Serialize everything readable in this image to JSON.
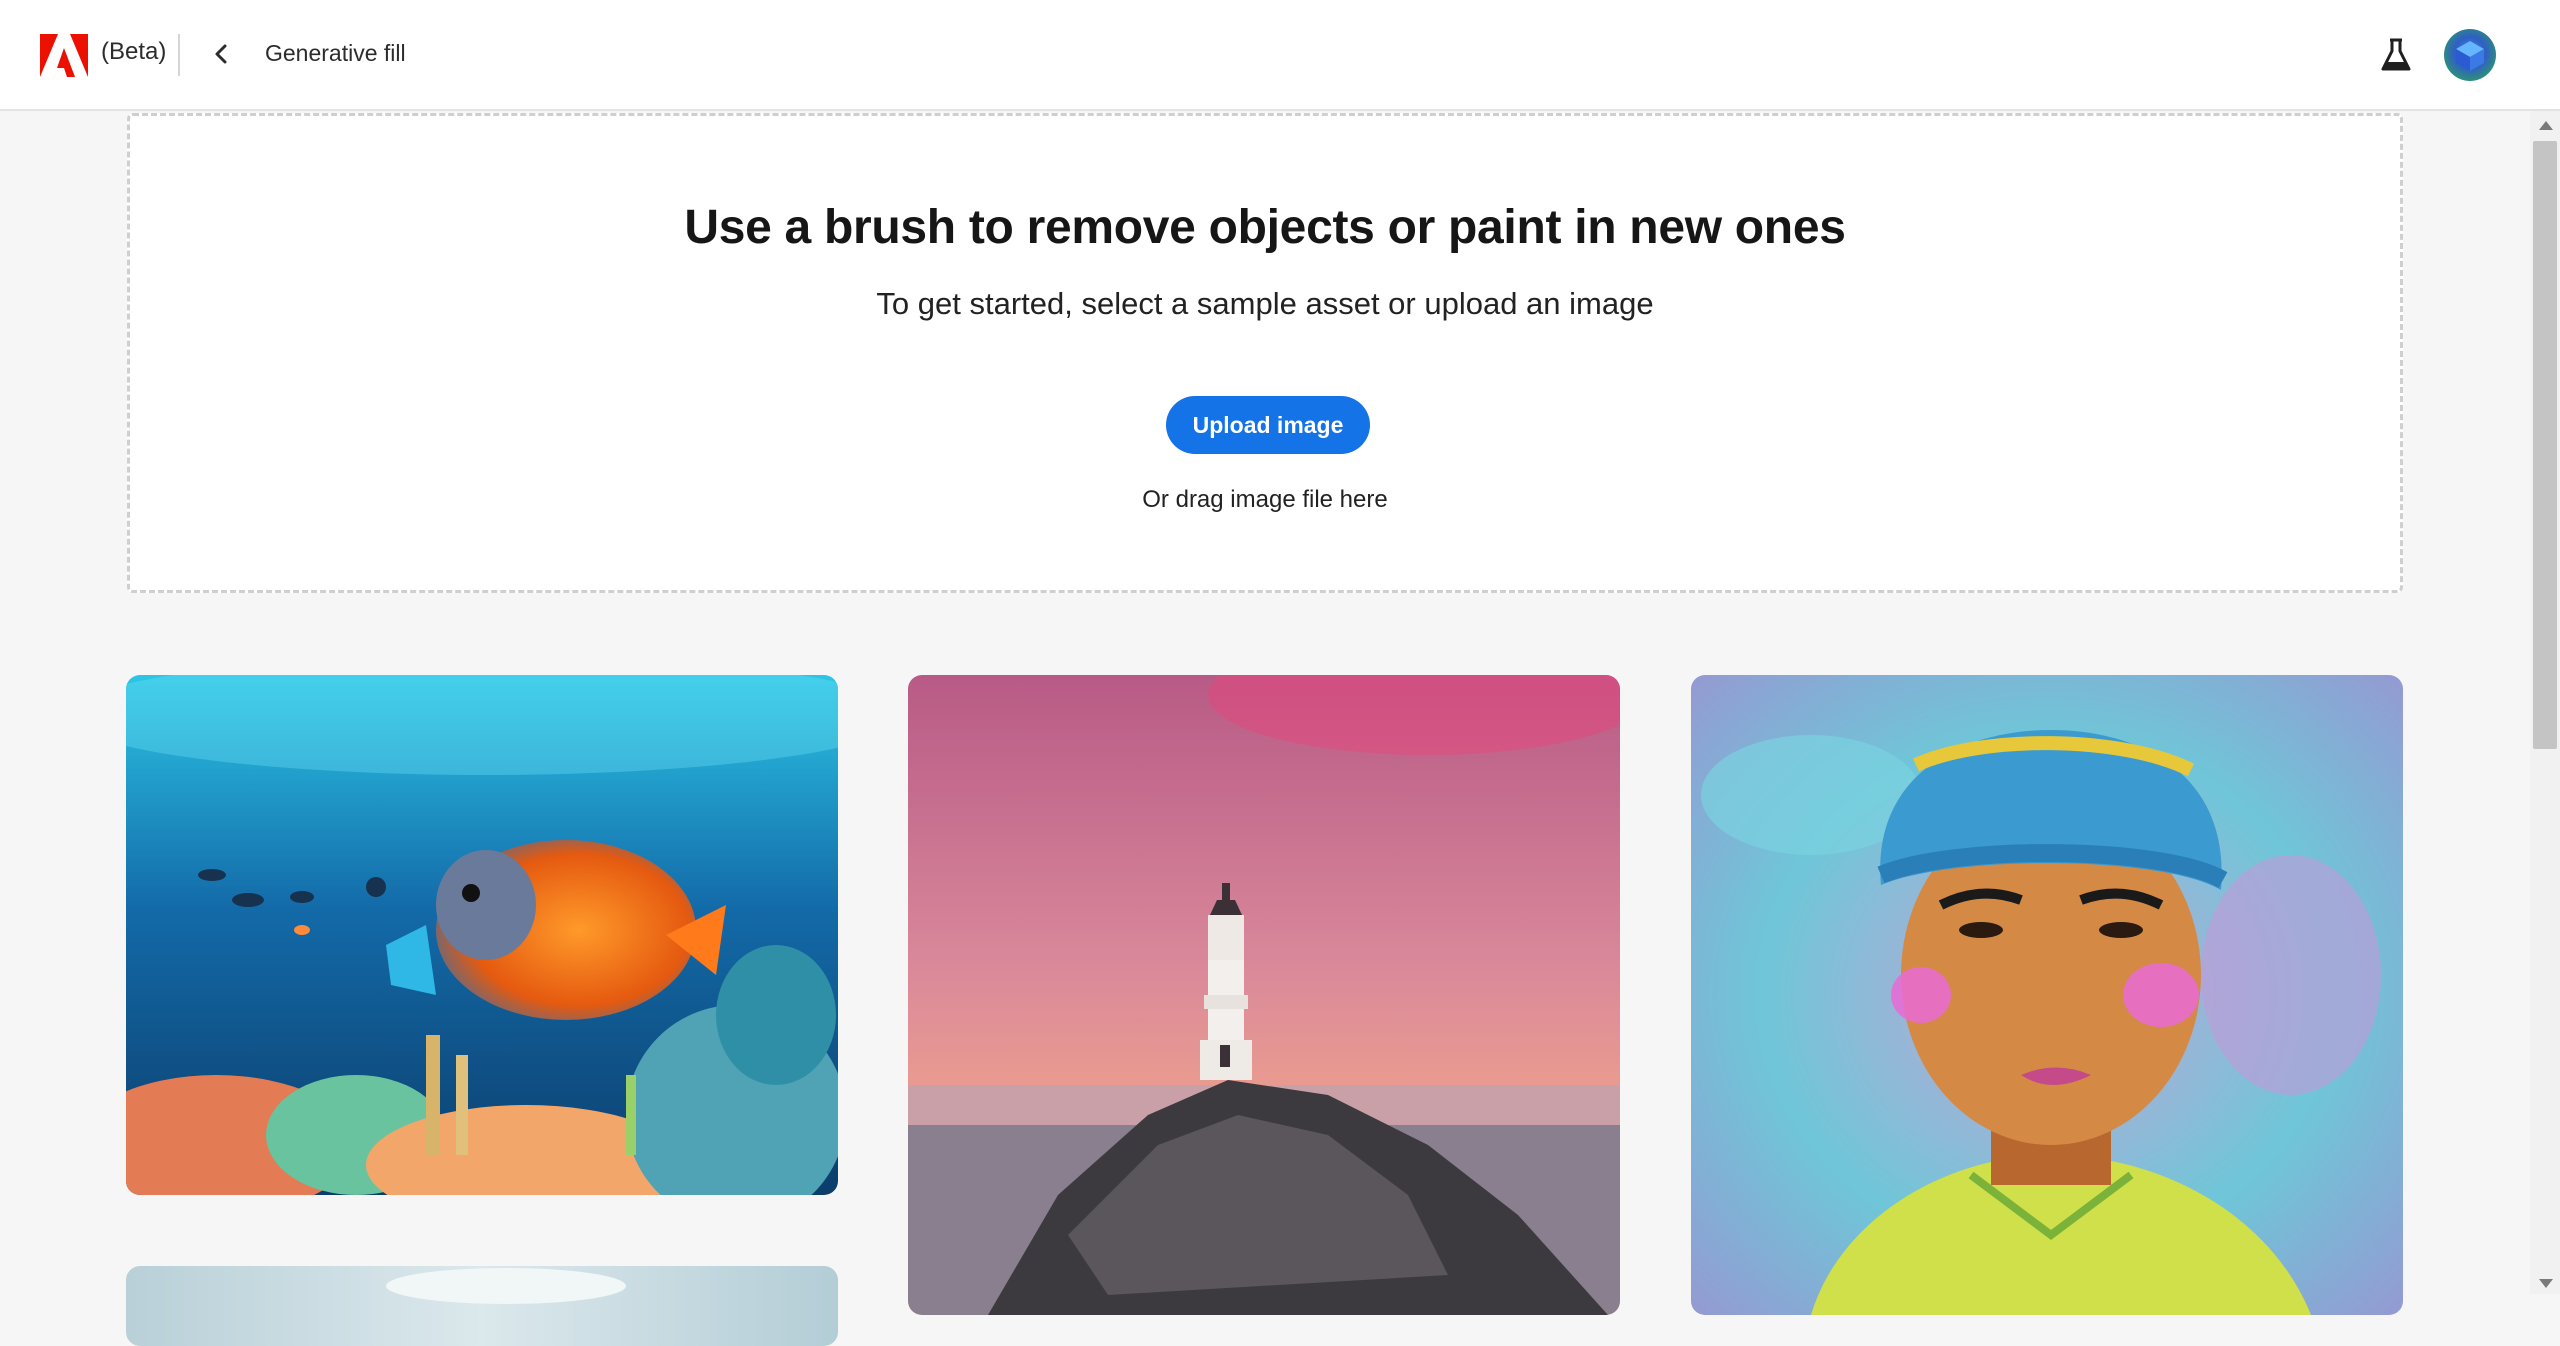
{
  "header": {
    "app_label": "(Beta)",
    "page_title": "Generative fill"
  },
  "dropzone": {
    "title": "Use a brush to remove objects or paint in new ones",
    "subtitle": "To get started, select a sample asset or upload an image",
    "upload_button": "Upload image",
    "drag_hint": "Or drag image file here"
  },
  "gallery": {
    "items": [
      {
        "name": "underwater-fish-sample",
        "icon": "image"
      },
      {
        "name": "lighthouse-sunset-sample",
        "icon": "image"
      },
      {
        "name": "portrait-beanie-sample",
        "icon": "image"
      },
      {
        "name": "sky-landscape-sample",
        "icon": "image"
      }
    ]
  },
  "colors": {
    "accent": "#1473e6",
    "adobe_red": "#eb1000",
    "background": "#f6f6f6"
  }
}
